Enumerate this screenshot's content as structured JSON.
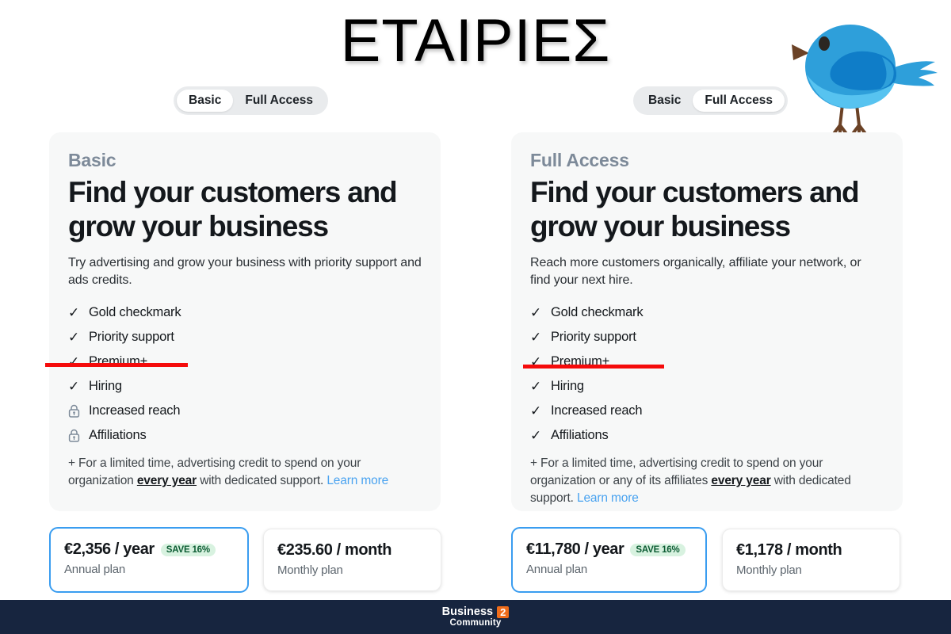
{
  "page": {
    "title": "ΕΤΑΙΡΙΕΣ",
    "background": "#ffffff",
    "accent_blue": "#3a9df0",
    "highlight_red": "#f50b0b",
    "badge_green_bg": "#d8f2e0",
    "badge_green_text": "#0c5c33",
    "card_bg": "#f7f8f8"
  },
  "illustration": {
    "name": "blue-bird-illustration",
    "body_color": "#2e9fda",
    "wing_color": "#0f7dc8",
    "belly_color": "#57c3f0",
    "beak_color": "#6b4226",
    "leg_color": "#6b4226",
    "eye_color": "#2b2622"
  },
  "toggles": [
    {
      "name": "plan-toggle-left",
      "options": [
        {
          "label": "Basic",
          "selected": true
        },
        {
          "label": "Full Access",
          "selected": false
        }
      ]
    },
    {
      "name": "plan-toggle-right",
      "options": [
        {
          "label": "Basic",
          "selected": false
        },
        {
          "label": "Full Access",
          "selected": true
        }
      ]
    }
  ],
  "cards": [
    {
      "plan_name": "Basic",
      "headline": "Find your customers and grow your business",
      "subhead": "Try advertising and grow your business with priority support and ads credits.",
      "features": [
        {
          "label": "Gold checkmark",
          "icon": "check-icon",
          "state": "included"
        },
        {
          "label": "Priority support",
          "icon": "check-icon",
          "state": "included"
        },
        {
          "label": "Premium+",
          "icon": "check-icon",
          "state": "included"
        },
        {
          "label": "Hiring",
          "icon": "check-icon",
          "state": "included"
        },
        {
          "label": "Increased reach",
          "icon": "lock-icon",
          "state": "locked"
        },
        {
          "label": "Affiliations",
          "icon": "lock-icon",
          "state": "locked"
        }
      ],
      "footnote": {
        "prefix": "+ For a limited time, advertising credit to spend on your organization ",
        "bold": "every year",
        "middle": " with dedicated support. ",
        "link": "Learn more"
      },
      "prices": [
        {
          "amount": "€2,356 / year",
          "badge": "SAVE 16%",
          "sub": "Annual plan",
          "selected": true
        },
        {
          "amount": "€235.60 / month",
          "badge": "",
          "sub": "Monthly plan",
          "selected": false
        }
      ]
    },
    {
      "plan_name": "Full Access",
      "headline": "Find your customers and grow your business",
      "subhead": "Reach more customers organically, affiliate your network, or find your next hire.",
      "features": [
        {
          "label": "Gold checkmark",
          "icon": "check-icon",
          "state": "included"
        },
        {
          "label": "Priority support",
          "icon": "check-icon",
          "state": "included"
        },
        {
          "label": "Premium+",
          "icon": "check-icon",
          "state": "included"
        },
        {
          "label": "Hiring",
          "icon": "check-icon",
          "state": "included"
        },
        {
          "label": "Increased reach",
          "icon": "check-icon",
          "state": "included"
        },
        {
          "label": "Affiliations",
          "icon": "check-icon",
          "state": "included"
        }
      ],
      "footnote": {
        "prefix": "+ For a limited time, advertising credit to spend on your organization or any of its affiliates ",
        "bold": "every year",
        "middle": " with dedicated support. ",
        "link": "Learn more"
      },
      "prices": [
        {
          "amount": "€11,780 / year",
          "badge": "SAVE 16%",
          "sub": "Annual plan",
          "selected": true
        },
        {
          "amount": "€1,178 / month",
          "badge": "",
          "sub": "Monthly plan",
          "selected": false
        }
      ]
    }
  ],
  "annotations": [
    {
      "name": "red-underline-left",
      "target": "Premium+",
      "color": "#f50b0b"
    },
    {
      "name": "red-underline-right",
      "target": "Premium+",
      "color": "#f50b0b"
    }
  ],
  "footer": {
    "logo_word1": "Business",
    "logo_badge": "2",
    "logo_word2": "Community",
    "background": "#17253f"
  },
  "icons": {
    "check": "✓",
    "lock": "lock-icon"
  }
}
